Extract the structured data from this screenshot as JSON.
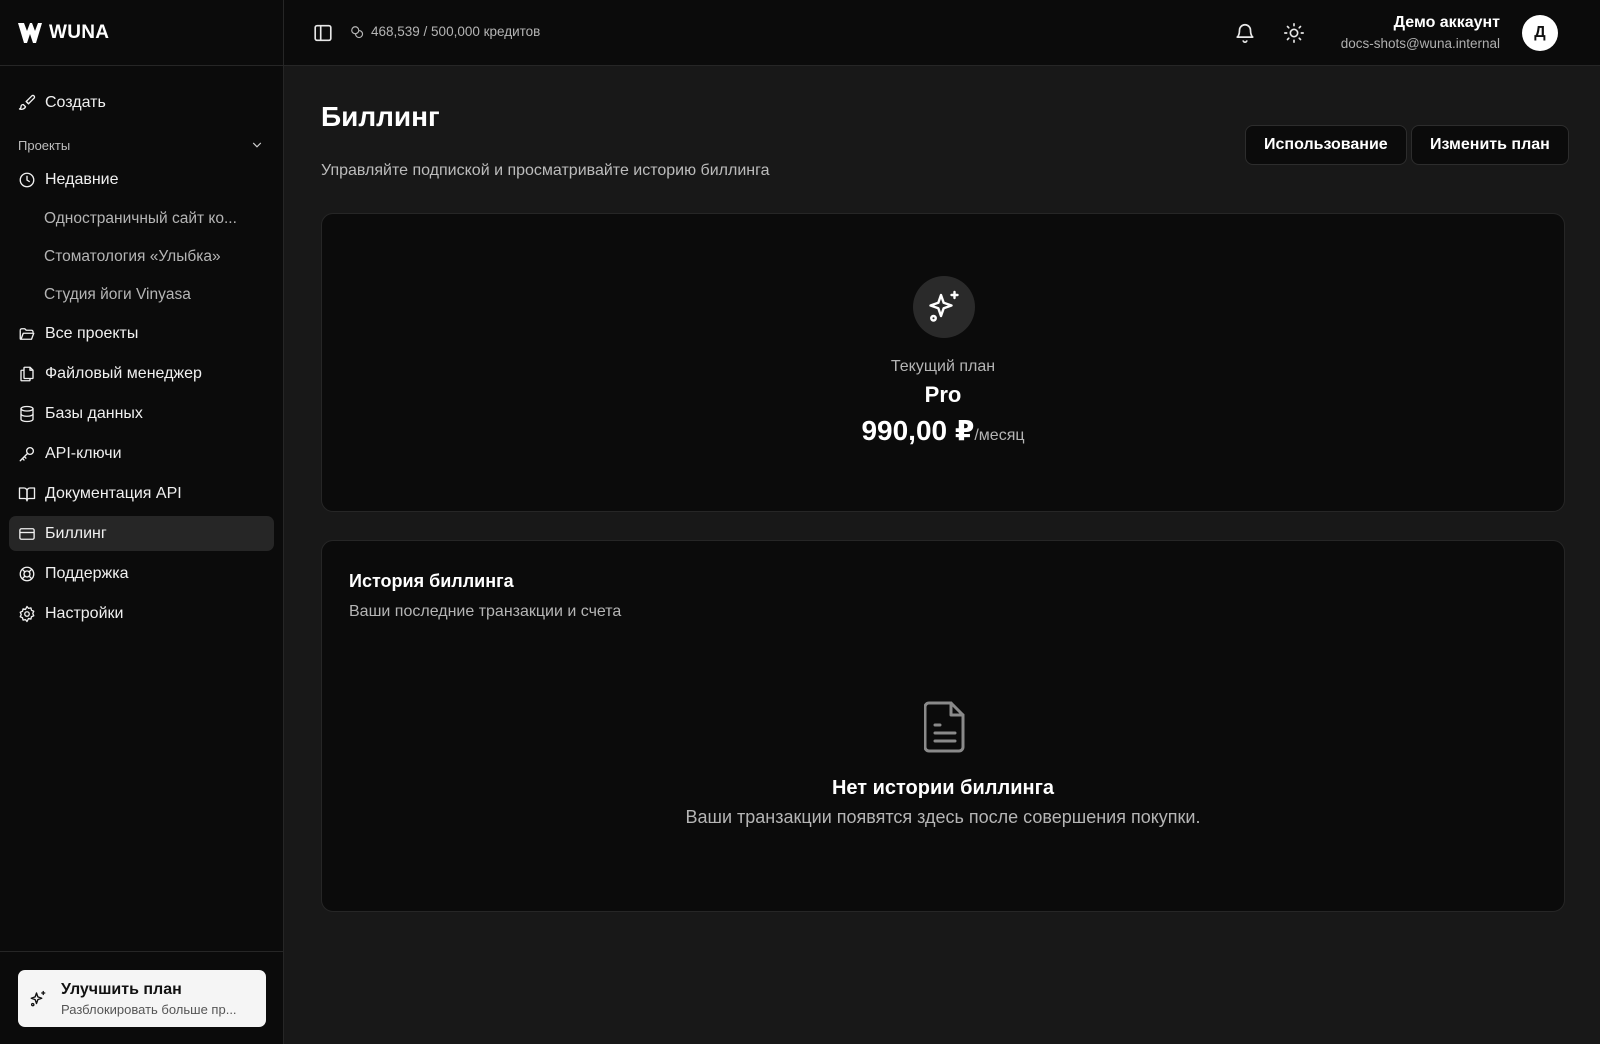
{
  "brand": {
    "name": "WUNA"
  },
  "topbar": {
    "credits": "468,539 / 500,000 кредитов",
    "user_name": "Демо аккаунт",
    "user_email": "docs-shots@wuna.internal",
    "avatar_initial": "Д"
  },
  "sidebar": {
    "create_label": "Создать",
    "projects_section": "Проекты",
    "recent_label": "Недавние",
    "recent_projects": [
      "Одностраничный сайт ко...",
      "Стоматология «Улыбка»",
      "Студия йоги Vinyasa"
    ],
    "items": [
      {
        "label": "Все проекты",
        "icon": "folder-open-icon"
      },
      {
        "label": "Файловый менеджер",
        "icon": "files-icon"
      },
      {
        "label": "Базы данных",
        "icon": "database-icon"
      },
      {
        "label": "API-ключи",
        "icon": "key-icon"
      },
      {
        "label": "Документация API",
        "icon": "book-open-icon"
      },
      {
        "label": "Биллинг",
        "icon": "credit-card-icon",
        "active": true
      },
      {
        "label": "Поддержка",
        "icon": "life-buoy-icon"
      },
      {
        "label": "Настройки",
        "icon": "gear-icon"
      }
    ],
    "upgrade": {
      "title": "Улучшить план",
      "subtitle": "Разблокировать больше пр..."
    }
  },
  "main": {
    "title": "Биллинг",
    "subtitle": "Управляйте подпиской и просматривайте историю биллинга",
    "usage_button": "Использование",
    "change_plan_button": "Изменить план",
    "plan": {
      "label": "Текущий план",
      "name": "Pro",
      "price": "990,00 ₽",
      "period": "/месяц"
    },
    "history": {
      "title": "История биллинга",
      "subtitle": "Ваши последние транзакции и счета",
      "empty_title": "Нет истории биллинга",
      "empty_subtitle": "Ваши транзакции появятся здесь после совершения покупки."
    }
  },
  "colors": {
    "background": "#181818",
    "panel": "#0b0b0b",
    "border": "#262626",
    "active_item": "#262626",
    "text": "#f2f2f2",
    "muted": "#b5b5b5"
  }
}
